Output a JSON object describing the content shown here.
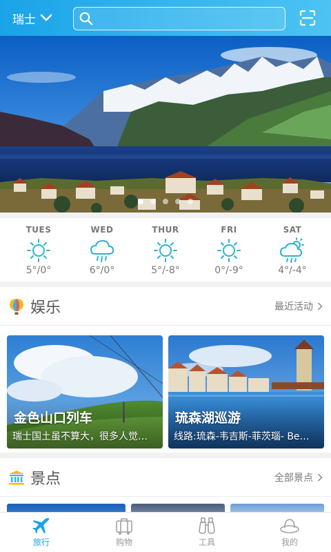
{
  "header": {
    "region": "瑞士",
    "search_placeholder": ""
  },
  "banner": {
    "slides": 5,
    "active": 0
  },
  "weather": [
    {
      "day": "TUES",
      "temp": "5°/0°",
      "icon": "sun-icon"
    },
    {
      "day": "WED",
      "temp": "6°/0°",
      "icon": "rain-cloud-icon"
    },
    {
      "day": "THUR",
      "temp": "5°/-8°",
      "icon": "sun-icon"
    },
    {
      "day": "FRI",
      "temp": "0°/-9°",
      "icon": "sun-icon"
    },
    {
      "day": "SAT",
      "temp": "4°/-4°",
      "icon": "sun-rain-icon"
    }
  ],
  "entertainment": {
    "title": "娱乐",
    "more": "最近活动",
    "cards": [
      {
        "title": "金色山口列车",
        "subtitle": "瑞士国土虽不算大，很多人觉…"
      },
      {
        "title": "琉森湖巡游",
        "subtitle": "线路:琉森-韦吉斯-菲茨瑙- Be…"
      }
    ]
  },
  "sights": {
    "title": "景点",
    "more": "全部景点"
  },
  "tabbar": {
    "items": [
      {
        "label": "旅行",
        "active": true
      },
      {
        "label": "购物",
        "active": false
      },
      {
        "label": "工具",
        "active": false
      },
      {
        "label": "我的",
        "active": false
      }
    ]
  },
  "colors": {
    "accent": "#1aa3e8",
    "weather_icon": "#2ab4cf"
  }
}
